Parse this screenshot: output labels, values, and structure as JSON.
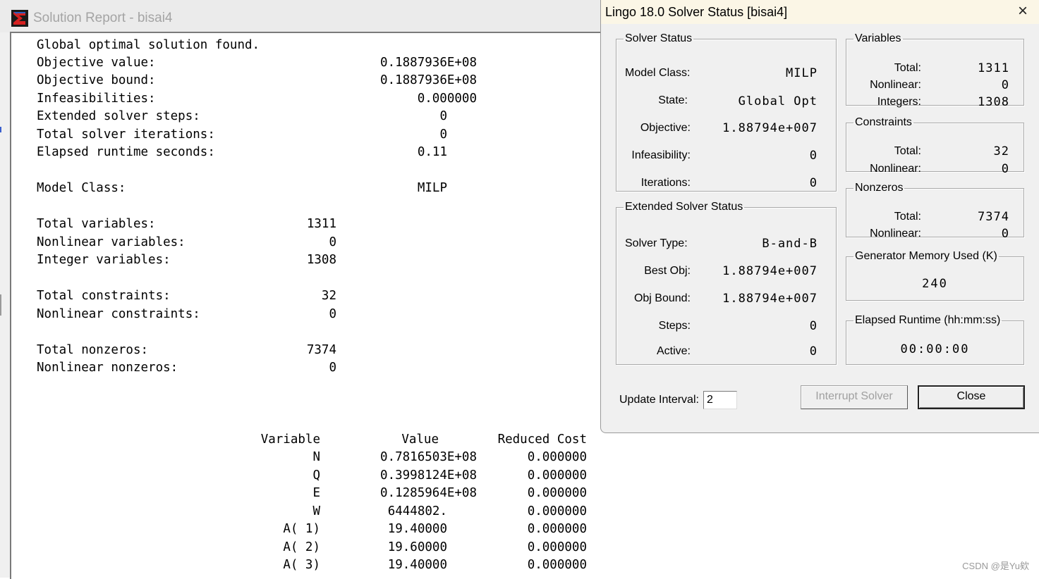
{
  "report": {
    "title": "Solution Report - bisai4",
    "summary": [
      {
        "label": "Global optimal solution found.",
        "value": ""
      },
      {
        "label": "Objective value:",
        "value": "0.1887936E+08"
      },
      {
        "label": "Objective bound:",
        "value": "0.1887936E+08"
      },
      {
        "label": "Infeasibilities:",
        "value": "0.000000"
      },
      {
        "label": "Extended solver steps:",
        "value": "0"
      },
      {
        "label": "Total solver iterations:",
        "value": "0"
      },
      {
        "label": "Elapsed runtime seconds:",
        "value": "0.11"
      }
    ],
    "model_class": {
      "label": "Model Class:",
      "value": "MILP"
    },
    "counts": [
      {
        "label": "Total variables:",
        "value": "1311"
      },
      {
        "label": "Nonlinear variables:",
        "value": "0"
      },
      {
        "label": "Integer variables:",
        "value": "1308"
      },
      {
        "label": "Total constraints:",
        "value": "32"
      },
      {
        "label": "Nonlinear constraints:",
        "value": "0"
      },
      {
        "label": "Total nonzeros:",
        "value": "7374"
      },
      {
        "label": "Nonlinear nonzeros:",
        "value": "0"
      }
    ],
    "table": {
      "headers": [
        "Variable",
        "Value",
        "Reduced Cost"
      ],
      "rows": [
        [
          "N",
          "0.7816503E+08",
          "0.000000"
        ],
        [
          "Q",
          "0.3998124E+08",
          "0.000000"
        ],
        [
          "E",
          "0.1285964E+08",
          "0.000000"
        ],
        [
          "W",
          "6444802.",
          "0.000000"
        ],
        [
          "A( 1)",
          "19.40000",
          "0.000000"
        ],
        [
          "A( 2)",
          "19.60000",
          "0.000000"
        ],
        [
          "A( 3)",
          "19.40000",
          "0.000000"
        ]
      ]
    }
  },
  "dialog": {
    "title": "Lingo 18.0 Solver Status [bisai4]",
    "close_icon": "×",
    "solver_status": {
      "legend": "Solver Status",
      "model_class_label": "Model Class:",
      "model_class": "MILP",
      "state_label": "State:",
      "state": "Global Opt",
      "objective_label": "Objective:",
      "objective": "1.88794e+007",
      "infeasibility_label": "Infeasibility:",
      "infeasibility": "0",
      "iterations_label": "Iterations:",
      "iterations": "0"
    },
    "extended": {
      "legend": "Extended Solver Status",
      "solver_type_label": "Solver Type:",
      "solver_type": "B-and-B",
      "best_obj_label": "Best Obj:",
      "best_obj": "1.88794e+007",
      "obj_bound_label": "Obj Bound:",
      "obj_bound": "1.88794e+007",
      "steps_label": "Steps:",
      "steps": "0",
      "active_label": "Active:",
      "active": "0"
    },
    "variables": {
      "legend": "Variables",
      "total_label": "Total:",
      "total": "1311",
      "nonlinear_label": "Nonlinear:",
      "nonlinear": "0",
      "integers_label": "Integers:",
      "integers": "1308"
    },
    "constraints": {
      "legend": "Constraints",
      "total_label": "Total:",
      "total": "32",
      "nonlinear_label": "Nonlinear:",
      "nonlinear": "0"
    },
    "nonzeros": {
      "legend": "Nonzeros",
      "total_label": "Total:",
      "total": "7374",
      "nonlinear_label": "Nonlinear:",
      "nonlinear": "0"
    },
    "memory": {
      "legend": "Generator Memory Used (K)",
      "value": "240"
    },
    "runtime": {
      "legend": "Elapsed Runtime (hh:mm:ss)",
      "value": "00:00:00"
    },
    "update_interval_label": "Update Interval:",
    "update_interval_value": "2",
    "interrupt_label": "Interrupt Solver",
    "close_label": "Close"
  },
  "watermark": "CSDN @是Yu欸"
}
